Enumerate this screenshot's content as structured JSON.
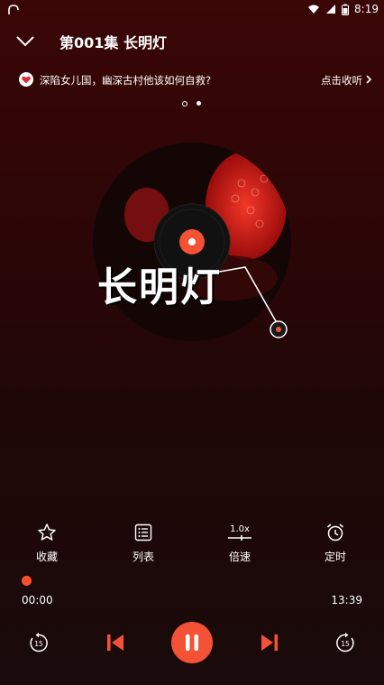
{
  "status_bar": {
    "time": "8:19",
    "left_icon": "signal-app-icon",
    "icons": [
      "wifi-icon",
      "signal-icon",
      "battery-icon"
    ]
  },
  "header": {
    "collapse_icon": "chevron-down-icon",
    "title": "第001集 长明灯"
  },
  "promo": {
    "text": "深陷女儿国，幽深古村他该如何自救?",
    "action": "点击收听",
    "icon": "heart-icon"
  },
  "pager": {
    "count": 2,
    "active_index": 1
  },
  "cover": {
    "art_text": "长明灯",
    "icon": "vinyl-record-icon"
  },
  "actions": [
    {
      "label": "收藏",
      "icon": "star-icon"
    },
    {
      "label": "列表",
      "icon": "list-icon"
    },
    {
      "label": "倍速",
      "icon": "speed-icon",
      "value": "1.0x"
    },
    {
      "label": "定时",
      "icon": "alarm-clock-icon"
    }
  ],
  "playback": {
    "current_time": "00:00",
    "duration": "13:39",
    "progress": 0
  },
  "controls": {
    "rewind_label": "15",
    "forward_label": "15",
    "icons": [
      "rewind-15-icon",
      "previous-icon",
      "pause-icon",
      "next-icon",
      "forward-15-icon"
    ]
  },
  "colors": {
    "accent": "#f45234",
    "background_top": "#3a0606",
    "background_bottom": "#1a0a0b"
  }
}
